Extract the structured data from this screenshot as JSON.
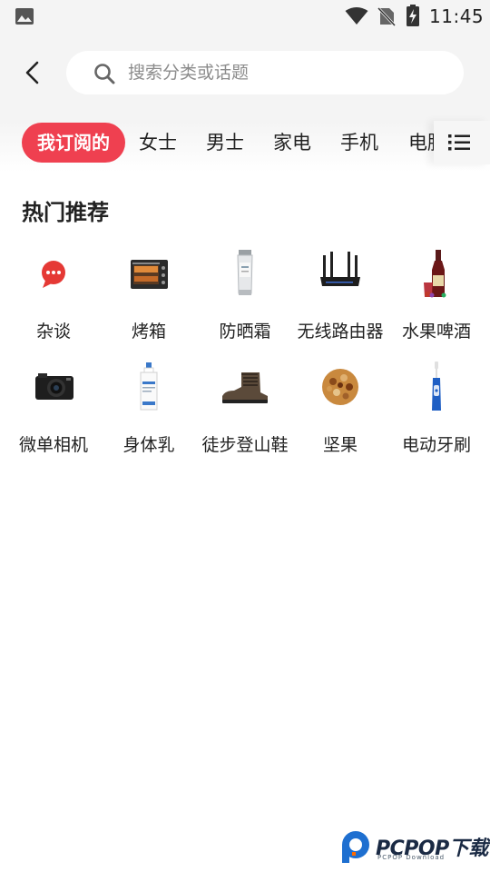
{
  "status_bar": {
    "time": "11:45"
  },
  "header": {
    "search_placeholder": "搜索分类或话题"
  },
  "tabs": [
    {
      "label": "我订阅的",
      "active": true
    },
    {
      "label": "女士"
    },
    {
      "label": "男士"
    },
    {
      "label": "家电"
    },
    {
      "label": "手机"
    },
    {
      "label": "电脑"
    }
  ],
  "section": {
    "title": "热门推荐",
    "items": [
      {
        "label": "杂谈",
        "icon": "chat-bubble-icon"
      },
      {
        "label": "烤箱",
        "icon": "oven-icon"
      },
      {
        "label": "防晒霜",
        "icon": "sunscreen-icon"
      },
      {
        "label": "无线路由器",
        "icon": "router-icon"
      },
      {
        "label": "水果啤酒",
        "icon": "beer-bottle-icon"
      },
      {
        "label": "微单相机",
        "icon": "camera-icon"
      },
      {
        "label": "身体乳",
        "icon": "lotion-bottle-icon"
      },
      {
        "label": "徒步登山鞋",
        "icon": "hiking-boot-icon"
      },
      {
        "label": "坚果",
        "icon": "nuts-icon"
      },
      {
        "label": "电动牙刷",
        "icon": "toothbrush-icon"
      }
    ]
  },
  "colors": {
    "accent": "#ef4050",
    "background_top": "#f4f4f4"
  },
  "watermark": {
    "brand": "PCPOP下载",
    "sub": "PCPOP Download"
  }
}
